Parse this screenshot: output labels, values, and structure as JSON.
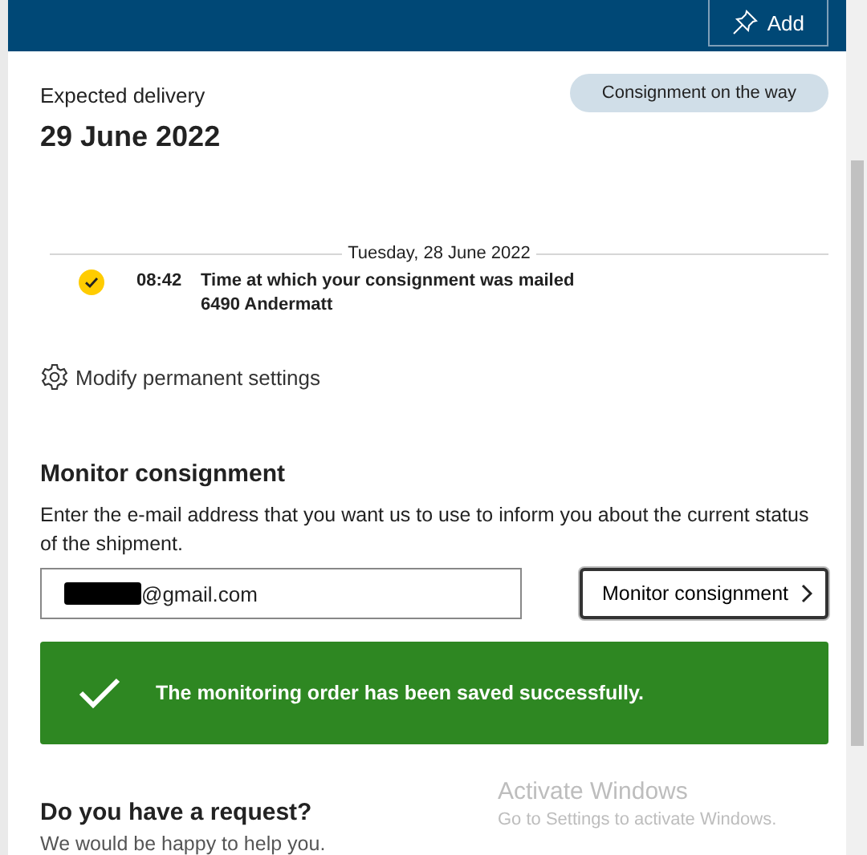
{
  "header": {
    "add_button": "Add"
  },
  "delivery": {
    "label": "Expected delivery",
    "date": "29 June 2022",
    "status": "Consignment on the way"
  },
  "timeline": {
    "date": "Tuesday, 28 June 2022",
    "events": [
      {
        "time": "08:42",
        "description": "Time at which your consignment was mailed",
        "location": "6490 Andermatt",
        "done": true
      }
    ]
  },
  "settings_link": "Modify permanent settings",
  "monitor": {
    "title": "Monitor consignment",
    "text": "Enter the e-mail address that you want us to use to inform you about the current status of the shipment.",
    "email": "@gmail.com",
    "button": "Monitor consignment"
  },
  "success": {
    "message": "The monitoring order has been saved successfully."
  },
  "request": {
    "title": "Do you have a request?",
    "text": "We would be happy to help you."
  },
  "os_overlay": {
    "title": "Activate Windows",
    "subtitle": "Go to Settings to activate Windows."
  }
}
